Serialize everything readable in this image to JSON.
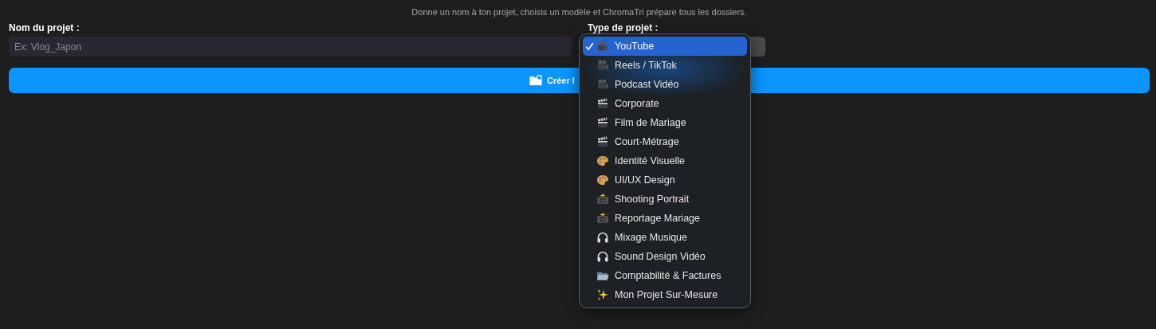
{
  "subtitle": "Donne un nom à ton projet, choisis un modèle et ChromaTri prépare tous les dossiers.",
  "name_field": {
    "label": "Nom du projet :",
    "placeholder": "Ex: Vlog_Japon"
  },
  "type_field": {
    "label": "Type de projet :",
    "options": [
      {
        "label": "YouTube",
        "kind": "video",
        "selected": true
      },
      {
        "label": "Reels / TikTok",
        "kind": "video",
        "selected": false
      },
      {
        "label": "Podcast Vidéo",
        "kind": "video",
        "selected": false
      },
      {
        "label": "Corporate",
        "kind": "film",
        "selected": false
      },
      {
        "label": "Film de Mariage",
        "kind": "film",
        "selected": false
      },
      {
        "label": "Court-Métrage",
        "kind": "film",
        "selected": false
      },
      {
        "label": "Identité Visuelle",
        "kind": "design",
        "selected": false
      },
      {
        "label": "UI/UX Design",
        "kind": "design",
        "selected": false
      },
      {
        "label": "Shooting Portrait",
        "kind": "photo",
        "selected": false
      },
      {
        "label": "Reportage Mariage",
        "kind": "photo",
        "selected": false
      },
      {
        "label": "Mixage Musique",
        "kind": "audio",
        "selected": false
      },
      {
        "label": "Sound Design Vidéo",
        "kind": "audio",
        "selected": false
      },
      {
        "label": "Comptabilité & Factures",
        "kind": "admin",
        "selected": false
      },
      {
        "label": "Mon Projet Sur-Mesure",
        "kind": "custom",
        "selected": false
      }
    ]
  },
  "create_button": {
    "label": "Créer l"
  }
}
